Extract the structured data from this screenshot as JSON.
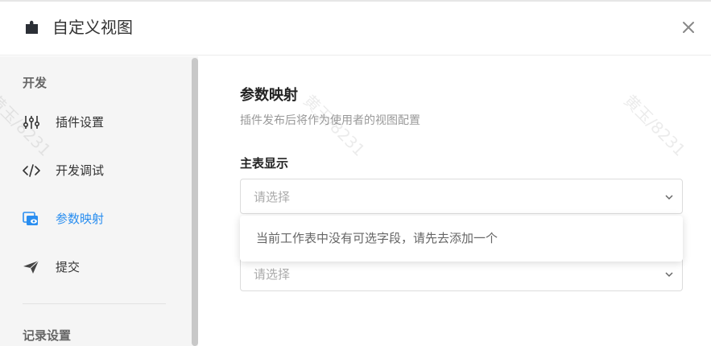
{
  "header": {
    "title": "自定义视图",
    "app_icon": "puzzle-icon",
    "close_icon": "close-icon"
  },
  "sidebar": {
    "sections": [
      {
        "title": "开发"
      },
      {
        "title": "记录设置"
      }
    ],
    "items": [
      {
        "label": "插件设置",
        "icon": "sliders-icon"
      },
      {
        "label": "开发调试",
        "icon": "code-icon"
      },
      {
        "label": "参数映射",
        "icon": "view-mapping-icon",
        "active": true
      },
      {
        "label": "提交",
        "icon": "send-icon"
      }
    ]
  },
  "main": {
    "heading": "参数映射",
    "subheading": "插件发布后将作为使用者的视图配置",
    "field_label": "主表显示",
    "select_1": {
      "placeholder": "请选择"
    },
    "dropdown": {
      "empty_message": "当前工作表中没有可选字段，请先去添加一个"
    },
    "select_2": {
      "placeholder": "请选择"
    }
  },
  "watermark": {
    "text": "黄玉/8231"
  },
  "colors": {
    "accent": "#2a8ef0",
    "sidebar_bg": "#f5f5f5",
    "text": "#333333",
    "muted": "#999999"
  }
}
